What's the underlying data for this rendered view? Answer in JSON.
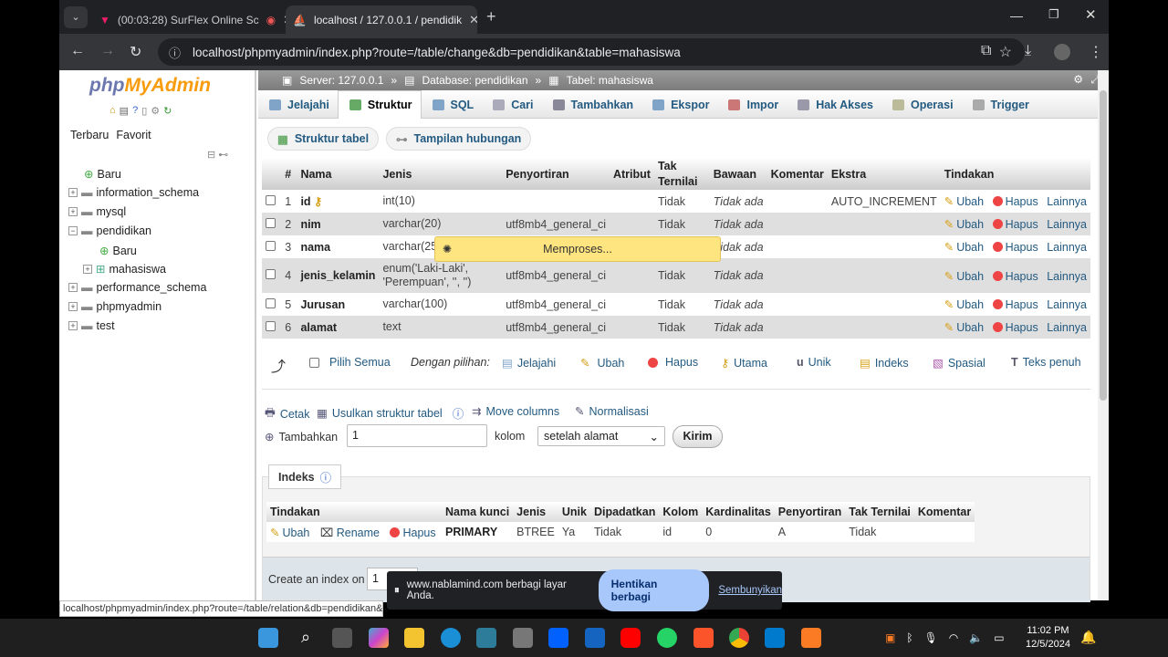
{
  "browser": {
    "tab1": "(00:03:28) SurFlex Online Sc",
    "tab2": "localhost / 127.0.0.1 / pendidik",
    "url": "localhost/phpmyadmin/index.php?route=/table/change&db=pendidikan&table=mahasiswa",
    "status_url": "localhost/phpmyadmin/index.php?route=/table/relation&db=pendidikan&..."
  },
  "sidebar": {
    "logo_php": "php",
    "logo_my": "MyAdmin",
    "recent": "Terbaru",
    "favorite": "Favorit",
    "tree": [
      "Baru",
      "information_schema",
      "mysql",
      "pendidikan",
      "Baru",
      "mahasiswa",
      "performance_schema",
      "phpmyadmin",
      "test"
    ]
  },
  "breadcrumb": {
    "server": "Server: 127.0.0.1",
    "database": "Database: pendidikan",
    "table": "Tabel: mahasiswa",
    "sep": "»"
  },
  "tabs": [
    "Jelajahi",
    "Struktur",
    "SQL",
    "Cari",
    "Tambahkan",
    "Ekspor",
    "Impor",
    "Hak Akses",
    "Operasi",
    "Trigger"
  ],
  "subtabs": [
    "Struktur tabel",
    "Tampilan hubungan"
  ],
  "structure": {
    "headers": [
      "#",
      "Nama",
      "Jenis",
      "Penyortiran",
      "Atribut",
      "Tak Ternilai",
      "Bawaan",
      "Komentar",
      "Ekstra",
      "Tindakan"
    ],
    "rows": [
      {
        "n": "1",
        "name": "id",
        "type": "int(10)",
        "coll": "",
        "null": "Tidak",
        "def": "Tidak ada",
        "extra": "AUTO_INCREMENT"
      },
      {
        "n": "2",
        "name": "nim",
        "type": "varchar(20)",
        "coll": "utf8mb4_general_ci",
        "null": "Tidak",
        "def": "Tidak ada",
        "extra": ""
      },
      {
        "n": "3",
        "name": "nama",
        "type": "varchar(25",
        "coll": "",
        "null": "",
        "def": "Tidak ada",
        "extra": ""
      },
      {
        "n": "4",
        "name": "jenis_kelamin",
        "type": "enum('Laki-Laki', 'Perempuan', '', '')",
        "coll": "utf8mb4_general_ci",
        "null": "Tidak",
        "def": "Tidak ada",
        "extra": ""
      },
      {
        "n": "5",
        "name": "Jurusan",
        "type": "varchar(100)",
        "coll": "utf8mb4_general_ci",
        "null": "Tidak",
        "def": "Tidak ada",
        "extra": ""
      },
      {
        "n": "6",
        "name": "alamat",
        "type": "text",
        "coll": "utf8mb4_general_ci",
        "null": "Tidak",
        "def": "Tidak ada",
        "extra": ""
      }
    ],
    "act_edit": "Ubah",
    "act_drop": "Hapus",
    "act_more": "Lainnya",
    "processing": "Memproses..."
  },
  "bulk": {
    "select_all": "Pilih Semua",
    "with_selected": "Dengan pilihan:",
    "actions": [
      "Jelajahi",
      "Ubah",
      "Hapus",
      "Utama",
      "Unik",
      "Indeks",
      "Spasial",
      "Teks penuh"
    ]
  },
  "tools": {
    "print": "Cetak",
    "propose": "Usulkan struktur tabel",
    "move": "Move columns",
    "normalize": "Normalisasi",
    "add_label": "Tambahkan",
    "add_value": "1",
    "col_label": "kolom",
    "after": "setelah alamat",
    "submit": "Kirim"
  },
  "indexes": {
    "title": "Indeks",
    "headers": [
      "Tindakan",
      "Nama kunci",
      "Jenis",
      "Unik",
      "Dipadatkan",
      "Kolom",
      "Kardinalitas",
      "Penyortiran",
      "Tak Ternilai",
      "Komentar"
    ],
    "row": {
      "edit": "Ubah",
      "rename": "Rename",
      "drop": "Hapus",
      "key": "PRIMARY",
      "type": "BTREE",
      "unique": "Ya",
      "packed": "Tidak",
      "col": "id",
      "card": "0",
      "coll": "A",
      "null": "Tidak",
      "comment": ""
    },
    "create_label": "Create an index on",
    "create_value": "1"
  },
  "share": {
    "text": "www.nablamind.com berbagi layar Anda.",
    "stop": "Hentikan berbagi",
    "hide": "Sembunyikan"
  },
  "clock": {
    "time": "11:02 PM",
    "date": "12/5/2024"
  }
}
